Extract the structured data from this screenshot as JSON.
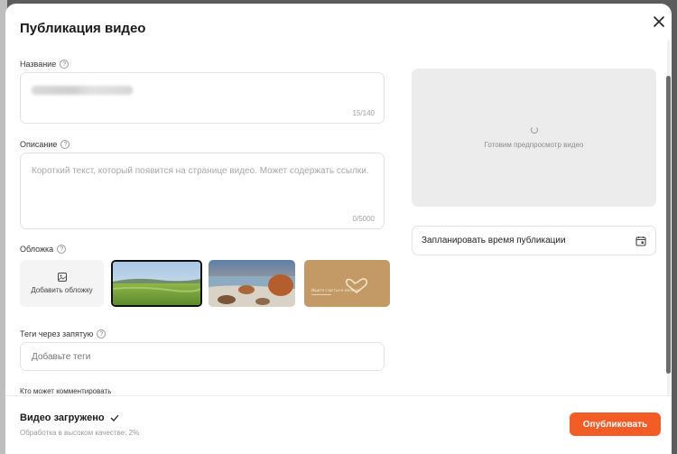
{
  "modal": {
    "title": "Публикация видео",
    "close_icon": "close-icon"
  },
  "form": {
    "name": {
      "label": "Название",
      "counter": "15/140"
    },
    "description": {
      "label": "Описание",
      "placeholder": "Короткий текст, который появится на странице видео. Может содержать ссылки.",
      "counter": "0/5000"
    },
    "cover": {
      "label": "Обложка",
      "add_label": "Добавить обложку",
      "thumb3_caption": "Ищите счастье в мелочах"
    },
    "tags": {
      "label": "Теги через запятую",
      "placeholder": "Добавьте теги"
    },
    "comments": {
      "label": "Кто может комментировать"
    }
  },
  "preview": {
    "text": "Готовим предпросмотр видео"
  },
  "schedule": {
    "label": "Запланировать время публикации",
    "icon": "calendar-icon"
  },
  "footer": {
    "status": "Видео загружено",
    "subtext": "Обработка в высоком качестве: 2%",
    "publish_label": "Опубликовать"
  },
  "colors": {
    "accent": "#f25c26",
    "selected_border": "#111111"
  }
}
